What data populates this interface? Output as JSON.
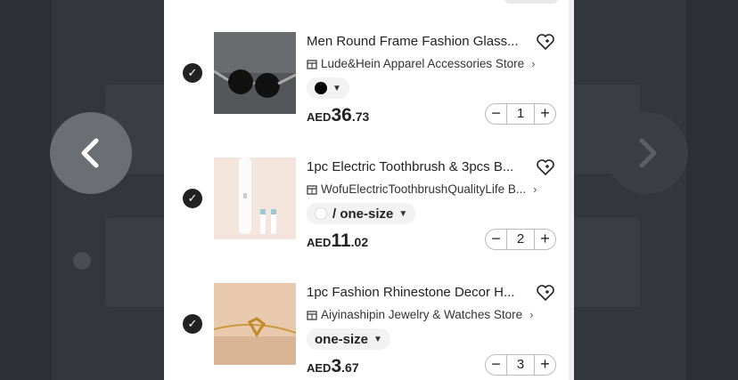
{
  "cart": {
    "items": [
      {
        "title": "Men Round Frame Fashion Glass...",
        "store": "Lude&Hein Apparel Accessories Store",
        "variant_label": "",
        "variant_color": "#000000",
        "currency": "AED",
        "price_int": "36",
        "price_dec": ".73",
        "quantity": "1",
        "selected": true
      },
      {
        "title": "1pc Electric Toothbrush & 3pcs B...",
        "store": "WofuElectricToothbrushQualityLife B...",
        "variant_label": "/ one-size",
        "variant_color": "#ffffff",
        "currency": "AED",
        "price_int": "11",
        "price_dec": ".02",
        "quantity": "2",
        "selected": true
      },
      {
        "title": "1pc Fashion Rhinestone Decor H...",
        "store": "Aiyinashipin Jewelry & Watches Store",
        "variant_label": "one-size",
        "variant_color": "",
        "currency": "AED",
        "price_int": "3",
        "price_dec": ".67",
        "quantity": "3",
        "selected": true
      }
    ]
  },
  "stepper": {
    "minus": "−",
    "plus": "+"
  },
  "icons": {
    "check": "check-icon",
    "wishlist": "heart-plus-icon",
    "store": "store-icon",
    "prev": "chevron-left-icon",
    "next": "chevron-right-icon"
  },
  "colors": {
    "overlay": "#2c2f33",
    "card": "#ffffff",
    "text": "#222222"
  }
}
